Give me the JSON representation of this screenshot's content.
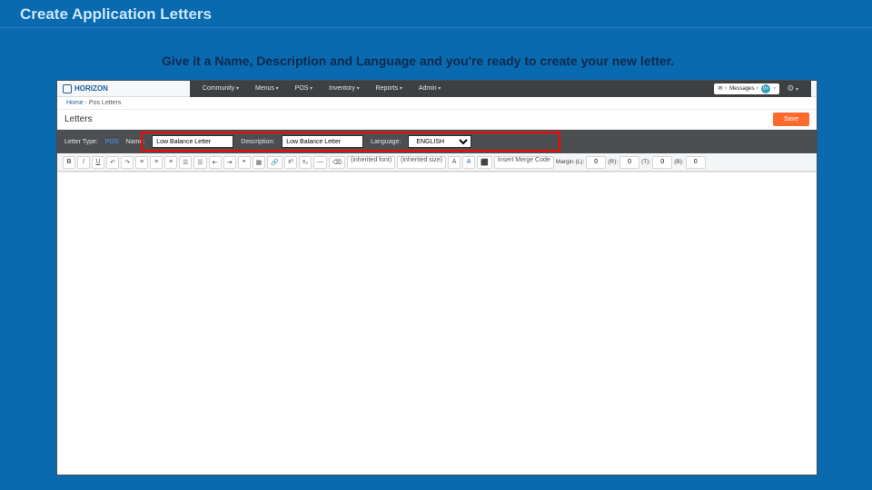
{
  "slide": {
    "title": "Create Application Letters",
    "subtitle": "Give it a Name, Description and Language and you're ready to create your new letter."
  },
  "app": {
    "brand": "HORIZON",
    "nav": [
      "Community",
      "Menus",
      "POS",
      "Inventory",
      "Reports",
      "Admin"
    ],
    "messages_label": "Messages",
    "messages_count": "0",
    "breadcrumbs": {
      "home": "Home",
      "mid": "Pos Letters",
      "sep": " › "
    },
    "page_title": "Letters",
    "save": "Save",
    "filter": {
      "letter_type_label": "Letter Type:",
      "letter_type_value": "POS",
      "name_label": "Name:",
      "name_value": "Low Balance Letter",
      "desc_label": "Description:",
      "desc_value": "Low Balance Letter",
      "lang_label": "Language:",
      "lang_value": "ENGLISH"
    },
    "toolbar": {
      "bold": "B",
      "italic": "I",
      "underline": "U",
      "undo": "↶",
      "redo": "↷",
      "align_l": "≡",
      "align_c": "≡",
      "align_r": "≡",
      "ol": "☰",
      "ul": "☰",
      "outdent": "⇤",
      "indent": "⇥",
      "quote": "❝",
      "table": "▦",
      "link": "🔗",
      "sup": "x²",
      "sub": "x₂",
      "hr": "—",
      "clear": "⌫",
      "font": "(inherited font)",
      "size": "(inherited size)",
      "fontfam": "A",
      "fontsize": "A",
      "color": "A",
      "bg": "⬛",
      "merge": "Insert Merge Code",
      "margin": "Margin (L):",
      "m_l": "0",
      "m_r_lbl": "(R):",
      "m_r": "0",
      "m_t_lbl": "(T):",
      "m_t": "0",
      "m_b_lbl": "(B):",
      "m_b": "0"
    }
  }
}
